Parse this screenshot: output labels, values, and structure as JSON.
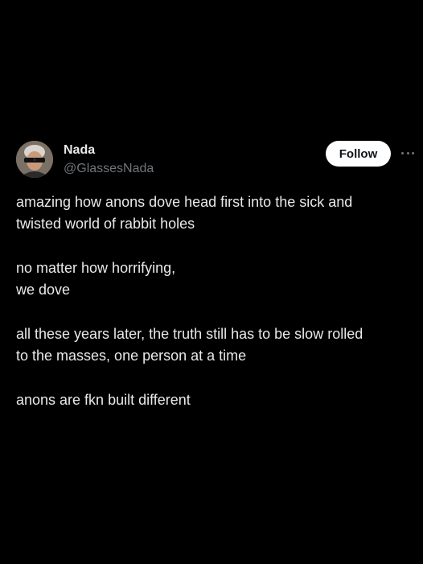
{
  "post": {
    "author": {
      "display_name": "Nada",
      "handle": "@GlassesNada",
      "avatar_icon": "user-avatar"
    },
    "follow_label": "Follow",
    "more_icon": "more-horizontal-icon",
    "paragraphs": [
      [
        "amazing how anons dove head first into the sick and",
        "twisted world of rabbit holes"
      ],
      [
        "no matter how horrifying,",
        "we dove"
      ],
      [
        "all these years later, the truth still has to be slow rolled",
        "to the masses, one person at a time"
      ],
      [
        "anons are fkn built different"
      ]
    ]
  },
  "colors": {
    "background": "#000000",
    "text_primary": "#e7e9ea",
    "text_secondary": "#71767b",
    "follow_bg": "#ffffff",
    "follow_text": "#0f1419"
  }
}
